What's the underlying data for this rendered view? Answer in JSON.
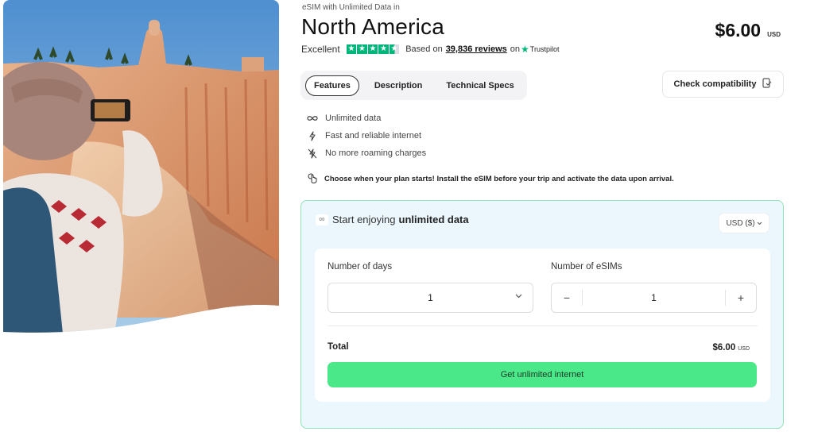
{
  "hero": {
    "image_description": "Traveler in wide-brim hat and patterned sweater photographing canyon hoodoos with a phone"
  },
  "product": {
    "eyebrow": "eSIM with Unlimited Data in",
    "title": "North America",
    "price": "$6.00",
    "currency": "USD"
  },
  "rating": {
    "label": "Excellent",
    "stars": 4.5,
    "stars_max": 5,
    "based_on": "Based on",
    "reviews": "39,836 reviews",
    "on": "on",
    "provider": "Trustpilot",
    "star_color": "#00b67a"
  },
  "tabs": [
    {
      "label": "Features",
      "active": true
    },
    {
      "label": "Description",
      "active": false
    },
    {
      "label": "Technical Specs",
      "active": false
    }
  ],
  "compat_button": {
    "label": "Check compatibility",
    "icon": "phone-check-icon"
  },
  "features": [
    {
      "icon": "infinity-icon",
      "label": "Unlimited data"
    },
    {
      "icon": "lightning-icon",
      "label": "Fast and reliable internet"
    },
    {
      "icon": "no-roaming-icon",
      "label": "No more roaming charges"
    }
  ],
  "note": {
    "icon": "hand-pointer-icon",
    "text": "Choose when your plan starts! Install the eSIM before your trip and activate the data upon arrival."
  },
  "panel": {
    "heading_prefix": "Start enjoying",
    "heading_bold": "unlimited data",
    "currency_select": "USD ($)",
    "days_label": "Number of days",
    "days_value": "1",
    "esims_label": "Number of eSIMs",
    "esims_value": "1",
    "minus": "−",
    "plus": "+",
    "total_label": "Total",
    "total_value": "$6.00",
    "total_currency": "USD",
    "cta": "Get unlimited internet",
    "accent_color": "#4ae888",
    "border_color": "#8fe3b6",
    "background_color": "#ebf7fc"
  }
}
